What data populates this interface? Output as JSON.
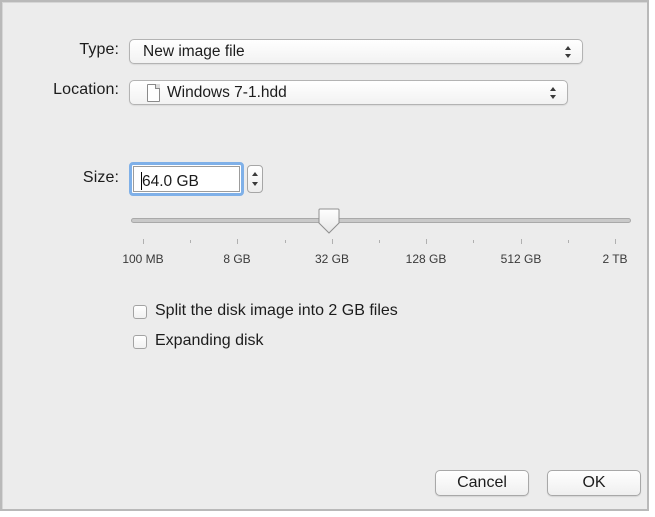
{
  "form": {
    "type_label": "Type:",
    "type_value": "New image file",
    "location_label": "Location:",
    "location_value": "Windows 7-1.hdd",
    "location_icon": "document-icon",
    "size_label": "Size:",
    "size_value": "64.0 GB"
  },
  "slider": {
    "ticks": [
      "100 MB",
      "8 GB",
      "32 GB",
      "128 GB",
      "512 GB",
      "2 TB"
    ],
    "selected_tick": "32 GB"
  },
  "options": {
    "split_label": "Split the disk image into 2 GB files",
    "split_checked": false,
    "expanding_label": "Expanding disk",
    "expanding_checked": false
  },
  "buttons": {
    "cancel_label": "Cancel",
    "ok_label": "OK"
  },
  "colors": {
    "dialog_background": "#ececec",
    "focus_ring": "#7fb0e8"
  }
}
